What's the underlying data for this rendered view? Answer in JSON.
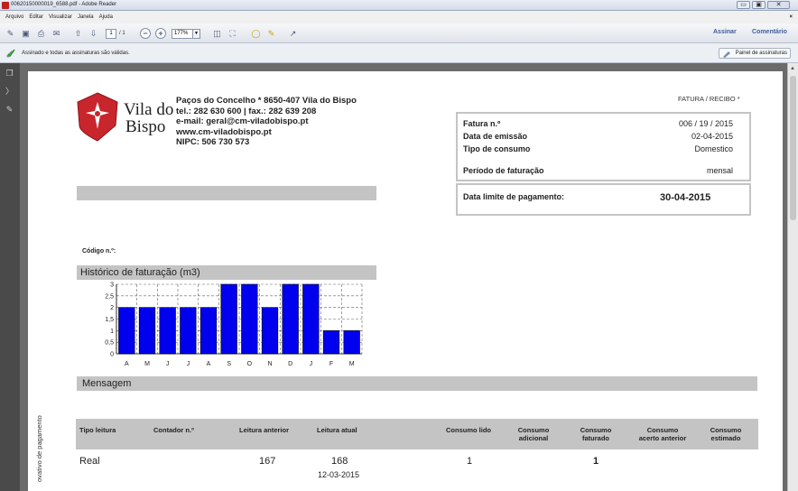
{
  "window": {
    "title": "00620150000019_6588.pdf - Adobe Reader",
    "minimize": "▭",
    "maximize": "▣",
    "close": "✕"
  },
  "menu": {
    "items": [
      "Arquivo",
      "Editar",
      "Visualizar",
      "Janela",
      "Ajuda"
    ],
    "close": "×"
  },
  "toolbar": {
    "page_current": "1",
    "page_total": "/ 1",
    "zoom": "177%",
    "assinar": "Assinar",
    "comentario": "Comentário"
  },
  "signature_bar": {
    "message": "Assinado e todas as assinaturas são válidas.",
    "panel_button": "Painel de assinaturas"
  },
  "document": {
    "logo_name_line1": "Vila do",
    "logo_name_line2": "Bispo",
    "address_lines": [
      "Paços do Concelho * 8650-407 Vila do Bispo",
      "tel.: 282 630 600 | fax.: 282 639 208",
      "e-mail: geral@cm-viladobispo.pt",
      "www.cm-viladobispo.pt",
      "NIPC: 506 730 573"
    ],
    "doc_type": "FATURA / RECIBO *",
    "info": [
      {
        "label": "Fatura n.º",
        "value": "006 / 19 / 2015"
      },
      {
        "label": "Data de emissão",
        "value": "02-04-2015"
      },
      {
        "label": "Tipo de consumo",
        "value": "Domestico"
      },
      {
        "label": "Período de faturação",
        "value": "mensal"
      }
    ],
    "due_label": "Data limite de pagamento:",
    "due_value": "30-04-2015",
    "codigo_label": "Código n.º:",
    "history_title": "Histórico de faturação (m3)",
    "message_title": "Mensagem",
    "side_text": "ovativo de pagamento",
    "table_headers": [
      "Tipo leitura",
      "Contador n.º",
      "Leitura anterior",
      "Leitura atual",
      "Consumo lido",
      "Consumo\nadicional",
      "Consumo\nfaturado",
      "Consumo\nacerto anterior",
      "Consumo\nestimado"
    ],
    "table_row": {
      "tipo": "Real",
      "leitura_anterior": "167",
      "leitura_atual": "168",
      "leitura_atual_data": "12-03-2015",
      "consumo_lido": "1",
      "consumo_faturado": "1"
    }
  },
  "chart_data": {
    "type": "bar",
    "categories": [
      "A",
      "M",
      "J",
      "J",
      "A",
      "S",
      "O",
      "N",
      "D",
      "J",
      "F",
      "M"
    ],
    "values": [
      2,
      2,
      2,
      2,
      2,
      3,
      3,
      2,
      3,
      3,
      1,
      1
    ],
    "title": "Histórico de faturação (m3)",
    "y_ticks": [
      "0",
      "0,5",
      "1",
      "1,5",
      "2",
      "2,5",
      "3"
    ],
    "ylim": [
      0,
      3
    ],
    "grid": true,
    "bar_color": "#0000ee"
  }
}
